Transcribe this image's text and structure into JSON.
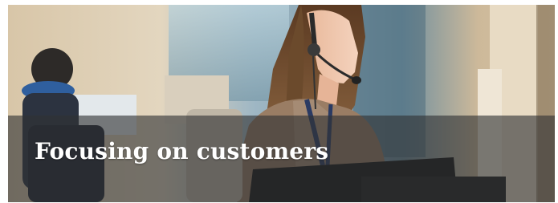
{
  "banner": {
    "caption": "Focusing on customers",
    "caption_color": "#ffffff",
    "overlay_color": "#303234"
  },
  "photo": {
    "subject": "customer-service-agent-with-headset"
  }
}
